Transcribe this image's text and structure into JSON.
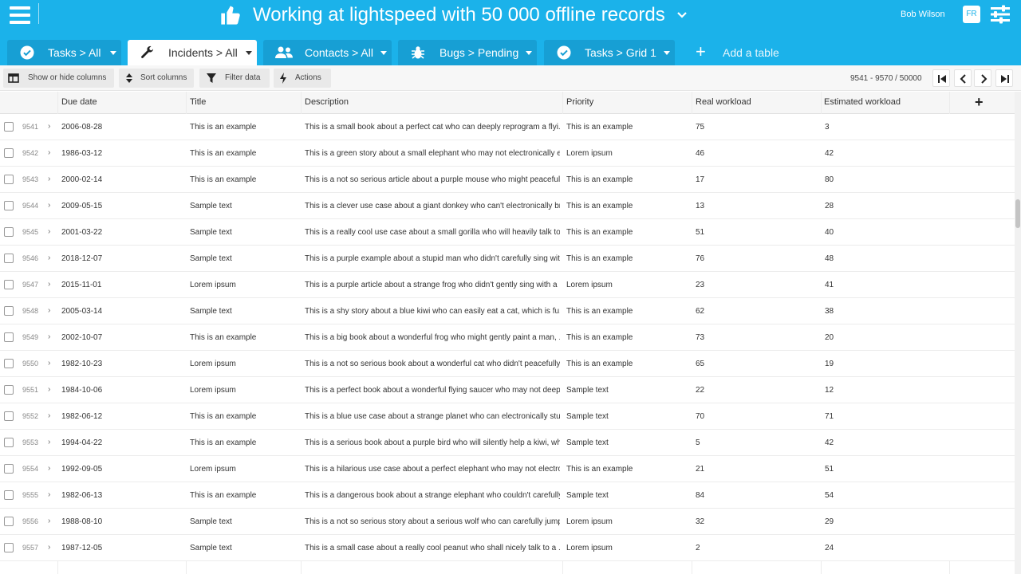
{
  "header": {
    "title": "Working at lightspeed with 50 000 offline records",
    "user": "Bob Wilson",
    "lang": "FR",
    "accent": "#1bb2ea"
  },
  "tabs": [
    {
      "label": "Tasks > All",
      "icon": "check-circle-icon",
      "active": false
    },
    {
      "label": "Incidents > All",
      "icon": "wrench-icon",
      "active": true
    },
    {
      "label": "Contacts > All",
      "icon": "users-icon",
      "active": false
    },
    {
      "label": "Bugs > Pending",
      "icon": "bug-icon",
      "active": false
    },
    {
      "label": "Tasks > Grid 1",
      "icon": "check-circle-icon",
      "active": false
    }
  ],
  "add_table": "Add a table",
  "toolbar": {
    "show_hide": "Show or hide columns",
    "sort": "Sort columns",
    "filter": "Filter data",
    "actions": "Actions"
  },
  "pager": "9541 - 9570 / 50000",
  "columns": [
    "Due date",
    "Title",
    "Description",
    "Priority",
    "Real workload",
    "Estimated workload"
  ],
  "rows": [
    {
      "id": "9541",
      "due": "2006-08-28",
      "title": "This is an example",
      "desc": "This is a small book about a perfect cat who can deeply reprogram a flyi...",
      "priority": "This is an example",
      "real": "75",
      "est": "3"
    },
    {
      "id": "9542",
      "due": "1986-03-12",
      "title": "This is an example",
      "desc": "This is a green story about a small elephant who may not electronically e...",
      "priority": "Lorem ipsum",
      "real": "46",
      "est": "42"
    },
    {
      "id": "9543",
      "due": "2000-02-14",
      "title": "This is an example",
      "desc": "This is a not so serious article about a purple mouse who might peacefull...",
      "priority": "This is an example",
      "real": "17",
      "est": "80"
    },
    {
      "id": "9544",
      "due": "2009-05-15",
      "title": "Sample text",
      "desc": "This is a clever use case about a giant donkey who can't electronically br...",
      "priority": "This is an example",
      "real": "13",
      "est": "28"
    },
    {
      "id": "9545",
      "due": "2001-03-22",
      "title": "Sample text",
      "desc": "This is a really cool use case about a small gorilla who will heavily talk to...",
      "priority": "This is an example",
      "real": "51",
      "est": "40"
    },
    {
      "id": "9546",
      "due": "2018-12-07",
      "title": "Sample text",
      "desc": "This is a purple example about a stupid man who didn't carefully sing wit...",
      "priority": "This is an example",
      "real": "76",
      "est": "48"
    },
    {
      "id": "9547",
      "due": "2015-11-01",
      "title": "Lorem ipsum",
      "desc": "This is a purple article about a strange frog who didn't gently sing with a ...",
      "priority": "Lorem ipsum",
      "real": "23",
      "est": "41"
    },
    {
      "id": "9548",
      "due": "2005-03-14",
      "title": "Sample text",
      "desc": "This is a shy story about a blue kiwi who can easily eat a cat, which is fu...",
      "priority": "This is an example",
      "real": "62",
      "est": "38"
    },
    {
      "id": "9549",
      "due": "2002-10-07",
      "title": "This is an example",
      "desc": "This is a big book about a wonderful frog who might gently paint a man, ...",
      "priority": "This is an example",
      "real": "73",
      "est": "20"
    },
    {
      "id": "9550",
      "due": "1982-10-23",
      "title": "Lorem ipsum",
      "desc": "This is a not so serious book about a wonderful cat who didn't peacefully ...",
      "priority": "This is an example",
      "real": "65",
      "est": "19"
    },
    {
      "id": "9551",
      "due": "1984-10-06",
      "title": "Lorem ipsum",
      "desc": "This is a perfect book about a wonderful flying saucer who may not deepl...",
      "priority": "Sample text",
      "real": "22",
      "est": "12"
    },
    {
      "id": "9552",
      "due": "1982-06-12",
      "title": "This is an example",
      "desc": "This is a blue use case about a strange planet who can electronically stu...",
      "priority": "Sample text",
      "real": "70",
      "est": "71"
    },
    {
      "id": "9553",
      "due": "1994-04-22",
      "title": "This is an example",
      "desc": "This is a serious book about a purple bird who will silently help a kiwi, wh...",
      "priority": "Sample text",
      "real": "5",
      "est": "42"
    },
    {
      "id": "9554",
      "due": "1992-09-05",
      "title": "Lorem ipsum",
      "desc": "This is a hilarious use case about a perfect elephant who may not electro...",
      "priority": "This is an example",
      "real": "21",
      "est": "51"
    },
    {
      "id": "9555",
      "due": "1982-06-13",
      "title": "This is an example",
      "desc": "This is a dangerous book about a strange elephant who couldn't carefully...",
      "priority": "Sample text",
      "real": "84",
      "est": "54"
    },
    {
      "id": "9556",
      "due": "1988-08-10",
      "title": "Sample text",
      "desc": "This is a not so serious story about a serious wolf who can carefully jump...",
      "priority": "Lorem ipsum",
      "real": "32",
      "est": "29"
    },
    {
      "id": "9557",
      "due": "1987-12-05",
      "title": "Sample text",
      "desc": "This is a small case about a really cool peanut who shall nicely talk to a ...",
      "priority": "Lorem ipsum",
      "real": "2",
      "est": "24"
    }
  ]
}
